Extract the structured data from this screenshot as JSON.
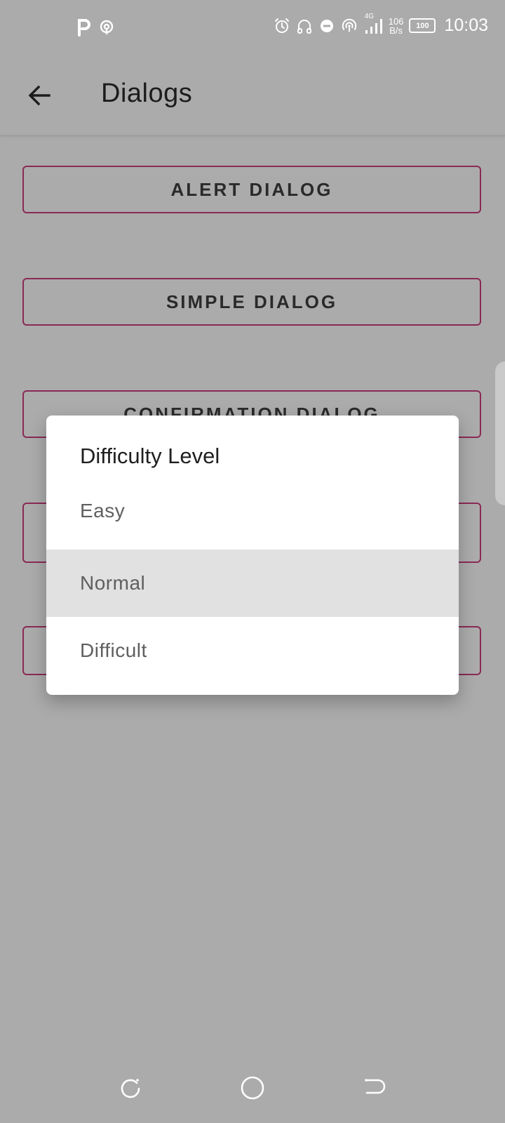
{
  "status_bar": {
    "time": "10:03",
    "net_speed_value": "106",
    "net_speed_unit": "B/s",
    "network_type": "4G",
    "battery_level": "100",
    "icons": [
      "parking-icon",
      "hotspot-icon",
      "alarm-icon",
      "headset-icon",
      "dnd-icon",
      "hotspot-signal-icon",
      "signal-icon",
      "battery-icon"
    ]
  },
  "app_bar": {
    "title": "Dialogs",
    "back_icon": "arrow-left-icon"
  },
  "buttons": [
    {
      "label": "ALERT DIALOG"
    },
    {
      "label": "SIMPLE DIALOG"
    },
    {
      "label": "CONFIRMATION DIALOG"
    },
    {
      "label": ""
    },
    {
      "label": ""
    }
  ],
  "dialog": {
    "title": "Difficulty Level",
    "options": [
      {
        "label": "Easy",
        "selected": false
      },
      {
        "label": "Normal",
        "selected": true
      },
      {
        "label": "Difficult",
        "selected": false
      }
    ]
  },
  "nav_bar": {
    "icons": [
      "recents-icon",
      "home-icon",
      "back-nav-icon"
    ]
  },
  "colors": {
    "scrim_background": "#ababab",
    "button_outline": "#8a2a55",
    "dialog_background": "#ffffff",
    "selected_option_bg": "#e1e1e1"
  }
}
